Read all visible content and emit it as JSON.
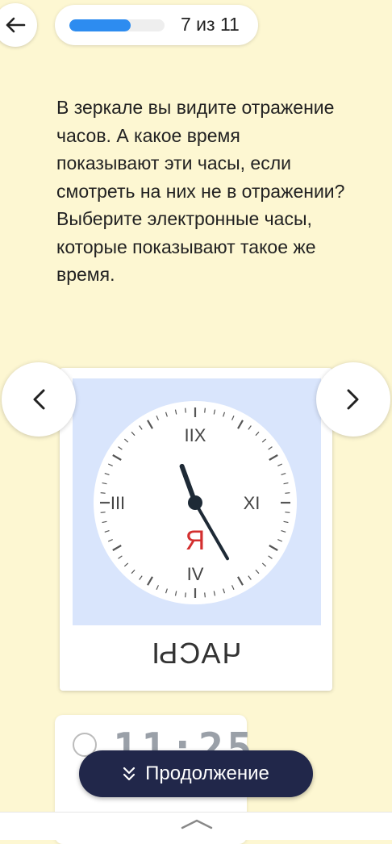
{
  "header": {
    "back_icon": "arrow-left-icon",
    "progress_text": "7 из 11",
    "progress_fraction": 0.64,
    "progress_color": "#2d8cf0"
  },
  "question": {
    "text": "В зеркале вы видите отражение часов. А какое время показывают эти часы, если смотреть на них не в отражении? Выберите электронные часы, которые показывают такое же время."
  },
  "clock": {
    "numerals": [
      "IIX",
      "XI",
      "IV",
      "III"
    ],
    "center_letter": "R",
    "caption": "ЧАСЫ",
    "hour_hand_angle": -20,
    "minute_hand_angle": 150
  },
  "nav": {
    "prev_icon": "chevron-left-icon",
    "next_icon": "chevron-right-icon"
  },
  "option_card": {
    "digits": "11:25"
  },
  "continue_button": {
    "label": "Продолжение",
    "icon": "double-chevron-down-icon"
  },
  "bottom": {
    "handle_icon": "chevron-up-icon"
  },
  "colors": {
    "background": "#fdf7d2",
    "button_dark": "#21274a",
    "clock_bg": "#d9e5fc",
    "letter_red": "#d32f2f"
  }
}
